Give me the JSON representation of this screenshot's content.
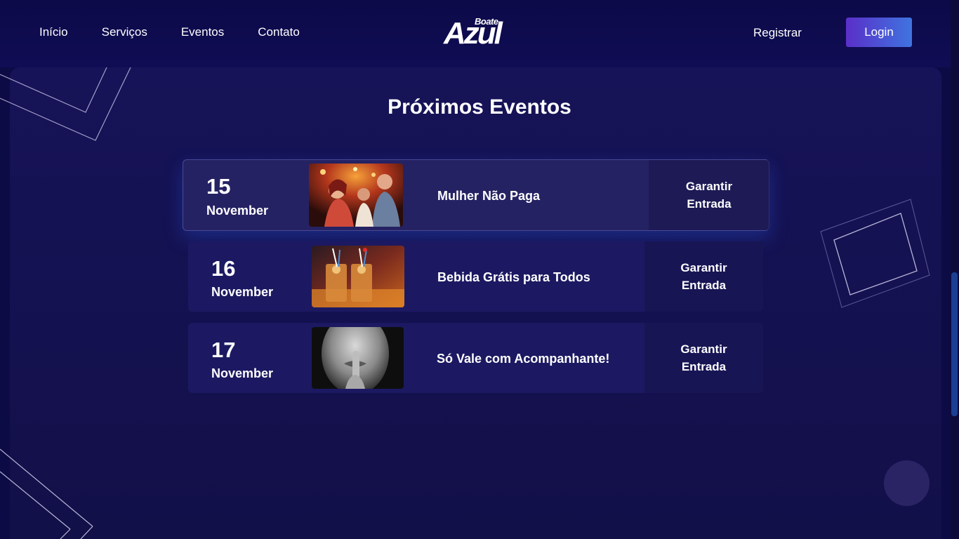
{
  "header": {
    "nav": [
      "Início",
      "Serviços",
      "Eventos",
      "Contato"
    ],
    "logo_top": "Boate",
    "logo_main": "Azul",
    "register_label": "Registrar",
    "login_label": "Login"
  },
  "page": {
    "title": "Próximos Eventos"
  },
  "events": [
    {
      "day": "15",
      "month": "November",
      "name": "Mulher Não Paga",
      "btn_line1": "Garantir",
      "btn_line2": "Entrada",
      "image": "party-crowd-photo"
    },
    {
      "day": "16",
      "month": "November",
      "name": "Bebida Grátis para Todos",
      "btn_line1": "Garantir",
      "btn_line2": "Entrada",
      "image": "cocktails-photo"
    },
    {
      "day": "17",
      "month": "November",
      "name": "Só Vale com Acompanhante!",
      "btn_line1": "Garantir",
      "btn_line2": "Entrada",
      "image": "woman-shush-photo"
    }
  ],
  "colors": {
    "background": "#0d0b45",
    "panel": "#161358",
    "accent_start": "#5a2fc9",
    "accent_end": "#3f74e0"
  }
}
